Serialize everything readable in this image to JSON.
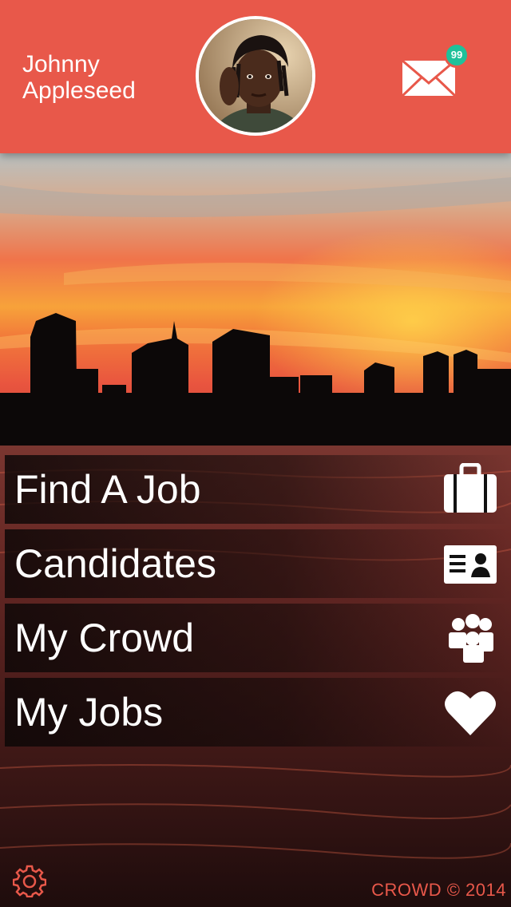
{
  "header": {
    "user_name": "Johnny Appleseed",
    "mail_badge": "99",
    "colors": {
      "background": "#E8584A",
      "badge": "#1fc19a"
    }
  },
  "menu": [
    {
      "label": "Find A Job",
      "icon": "briefcase-icon"
    },
    {
      "label": "Candidates",
      "icon": "id-card-icon"
    },
    {
      "label": "My Crowd",
      "icon": "group-icon"
    },
    {
      "label": "My Jobs",
      "icon": "heart-icon"
    }
  ],
  "footer": {
    "copyright": "CROWD © 2014",
    "settings_icon": "gear-icon"
  }
}
